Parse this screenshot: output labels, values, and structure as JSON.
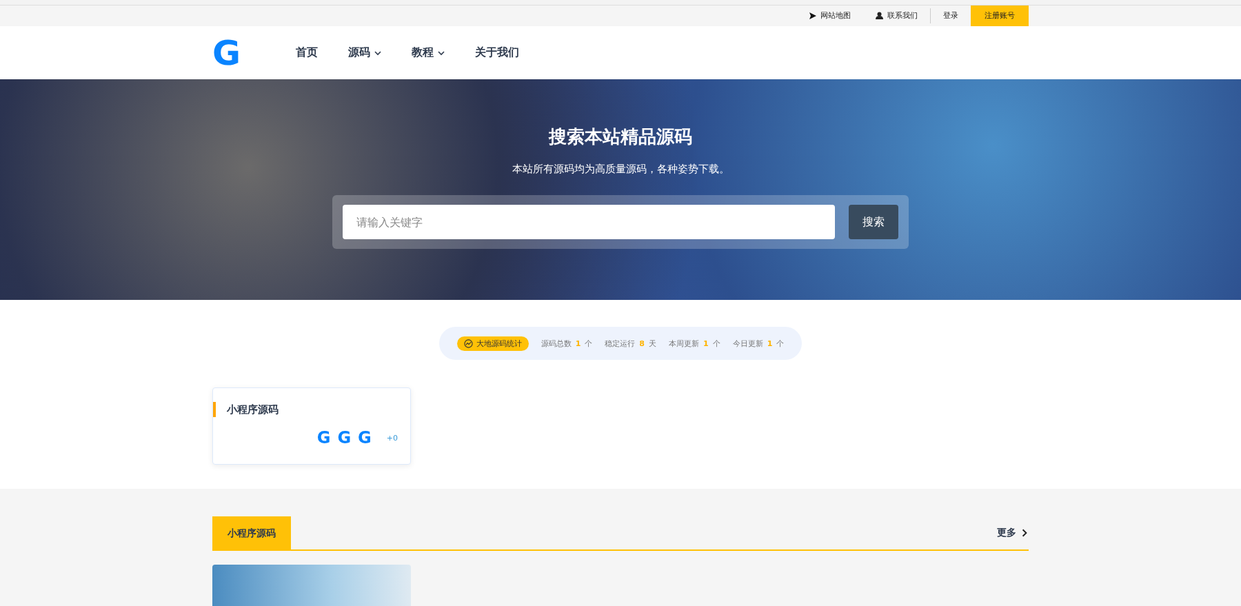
{
  "top_bar": {
    "links": [
      {
        "kind": "sitemap",
        "label": "网站地图"
      },
      {
        "kind": "contact",
        "label": "联系我们"
      },
      {
        "kind": "login",
        "label": "登录"
      },
      {
        "kind": "register",
        "label": "注册账号"
      }
    ]
  },
  "header": {
    "logo": "G",
    "nav": [
      {
        "label": "首页",
        "dropdown": false
      },
      {
        "label": "源码",
        "dropdown": true
      },
      {
        "label": "教程",
        "dropdown": true
      },
      {
        "label": "关于我们",
        "dropdown": false
      }
    ]
  },
  "hero": {
    "title": "搜索本站精品源码",
    "subtitle": "本站所有源码均为高质量源码，各种姿势下载。",
    "search": {
      "placeholder": "请输入关键字",
      "button": "搜索"
    }
  },
  "stats": {
    "badge": "大地源码统计",
    "items": [
      {
        "label": "源码总数",
        "value": "1",
        "unit": "个"
      },
      {
        "label": "稳定运行",
        "value": "8",
        "unit": "天"
      },
      {
        "label": "本周更新",
        "value": "1",
        "unit": "个"
      },
      {
        "label": "今日更新",
        "value": "1",
        "unit": "个"
      }
    ]
  },
  "category_cards": [
    {
      "title": "小程序源码",
      "avatars": [
        "G",
        "G",
        "G"
      ],
      "count": "+0"
    }
  ],
  "section": {
    "tab": "小程序源码",
    "more": "更多"
  }
}
